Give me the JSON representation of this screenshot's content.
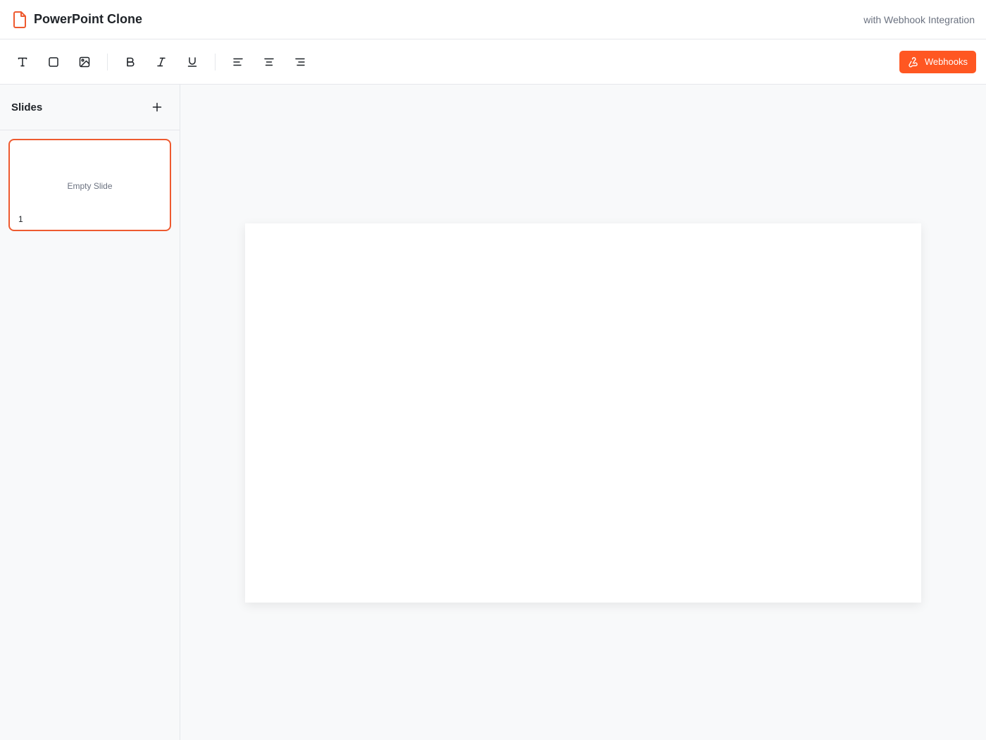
{
  "header": {
    "title": "PowerPoint Clone",
    "subtitle": "with Webhook Integration"
  },
  "toolbar": {
    "tools": [
      {
        "name": "text-tool",
        "icon": "text-icon"
      },
      {
        "name": "shape-tool",
        "icon": "square-icon"
      },
      {
        "name": "image-tool",
        "icon": "image-icon"
      },
      {
        "name": "bold-button",
        "icon": "bold-icon"
      },
      {
        "name": "italic-button",
        "icon": "italic-icon"
      },
      {
        "name": "underline-button",
        "icon": "underline-icon"
      },
      {
        "name": "align-left-button",
        "icon": "align-left-icon"
      },
      {
        "name": "align-center-button",
        "icon": "align-center-icon"
      },
      {
        "name": "align-right-button",
        "icon": "align-right-icon"
      }
    ],
    "webhooks_label": "Webhooks"
  },
  "sidebar": {
    "title": "Slides",
    "slides": [
      {
        "number": "1",
        "label": "Empty Slide",
        "selected": true
      }
    ]
  },
  "colors": {
    "accent": "#ff5722",
    "selected_border": "#ee5a2f",
    "background": "#f8f9fa",
    "border": "#e5e7eb"
  }
}
